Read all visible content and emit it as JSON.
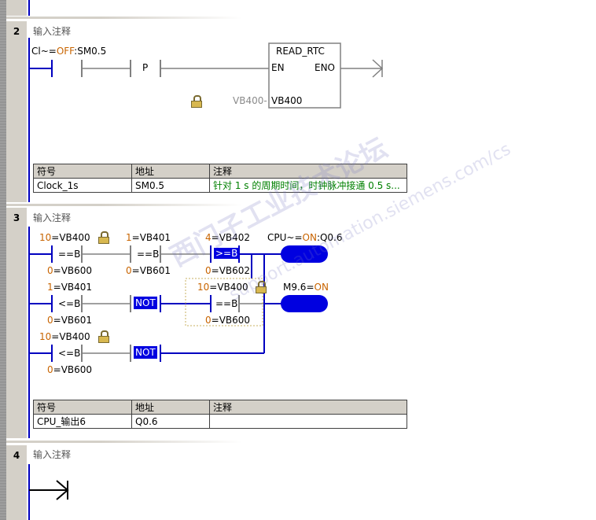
{
  "networks": [
    {
      "number": "2",
      "comment": "输入注释",
      "contact1": {
        "prefix": "Cl~=",
        "state": "OFF",
        "suffix": ":SM0.5"
      },
      "pos_edge": "P",
      "block": {
        "title": "READ_RTC",
        "en": "EN",
        "eno": "ENO",
        "param": "VB400",
        "param_value": "VB400-"
      },
      "table": {
        "headers": [
          "符号",
          "地址",
          "注释"
        ],
        "rows": [
          [
            "Clock_1s",
            "SM0.5",
            "针对 1 s 的周期时间，时钟脉冲接通 0.5 s..."
          ]
        ]
      }
    },
    {
      "number": "3",
      "comment": "输入注释",
      "c1": {
        "top_val": "10",
        "top_addr": "=VB400",
        "op": "==B",
        "bot_val": "0",
        "bot_addr": "=VB600"
      },
      "c2": {
        "top_val": "1",
        "top_addr": "=VB401",
        "op": "==B",
        "bot_val": "0",
        "bot_addr": "=VB601"
      },
      "c3": {
        "top_val": "4",
        "top_addr": "=VB402",
        "op": ">=B",
        "bot_val": "0",
        "bot_addr": "=VB602"
      },
      "coil1": {
        "prefix": "CPU~=",
        "state": "ON",
        "suffix": ":Q0.6"
      },
      "c4": {
        "top_val": "1",
        "top_addr": "=VB401",
        "op": "<=B",
        "bot_val": "0",
        "bot_addr": "=VB601"
      },
      "not1": "NOT",
      "c5": {
        "top_val": "10",
        "top_addr": "=VB400",
        "op": "==B",
        "bot_val": "0",
        "bot_addr": "=VB600"
      },
      "coil2": {
        "prefix": "M9.6=",
        "state": "ON"
      },
      "c6": {
        "top_val": "10",
        "top_addr": "=VB400",
        "op": "<=B",
        "bot_val": "0",
        "bot_addr": "=VB600"
      },
      "not2": "NOT",
      "table": {
        "headers": [
          "符号",
          "地址",
          "注释"
        ],
        "rows": [
          [
            "CPU_输出6",
            "Q0.6",
            ""
          ]
        ]
      }
    },
    {
      "number": "4",
      "comment": "输入注释"
    }
  ],
  "watermark": {
    "line1": "西门子工业技术论坛",
    "line2": "support.automation.siemens.com/cs"
  },
  "colors": {
    "highlight": "#0000e0",
    "rail": "#0000c0",
    "wire": "#808080",
    "on": "#c86400",
    "off": "#c86400"
  }
}
